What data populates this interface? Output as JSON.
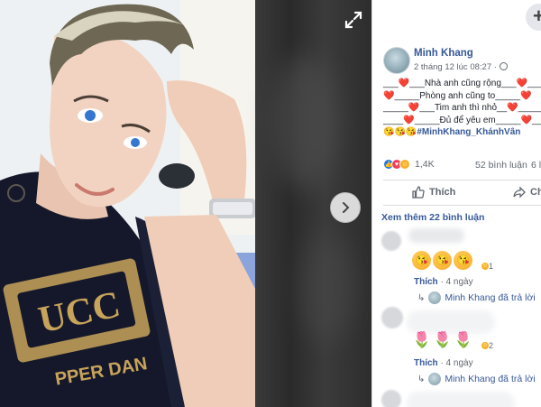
{
  "viewer": {
    "expand_icon": "expand-icon",
    "next_icon": "chevron-right-icon"
  },
  "panel": {
    "plus_label": "+",
    "author": "Minh Khang",
    "timestamp": "2 tháng 12 lúc 08:27 ·",
    "post_lines": [
      "___❤️___Nhà anh cũng rộng___❤️___",
      "❤️_____Phòng anh cũng to_____❤️",
      "_____❤️___Tim anh thì nhỏ__❤️_____",
      "____❤️_____Đủ để yêu em_____❤️____",
      "😘😘😘"
    ],
    "hashtag": "#MinhKhang_KhánhVân",
    "reaction_count": "1,4K",
    "comment_count": "52 bình luận",
    "share_count": "6 l",
    "like_label": "Thích",
    "share_label": "Chi",
    "see_more": "Xem thêm 22 bình luận",
    "comments": [
      {
        "emoji": [
          "😘",
          "😘",
          "😘"
        ],
        "mini_react_count": "1",
        "like": "Thích",
        "time": "· 4 ngày",
        "reply": "Minh Khang đã trả lời"
      },
      {
        "emoji": [
          "🌷",
          "🌷",
          "🌷"
        ],
        "mini_react_count": "2",
        "like": "Thích",
        "time": "· 4 ngày",
        "reply": "Minh Khang đã trả lời"
      }
    ]
  },
  "colors": {
    "link": "#365899",
    "muted": "#616770",
    "like_blue": "#1877f2",
    "love_red": "#f33e58"
  }
}
